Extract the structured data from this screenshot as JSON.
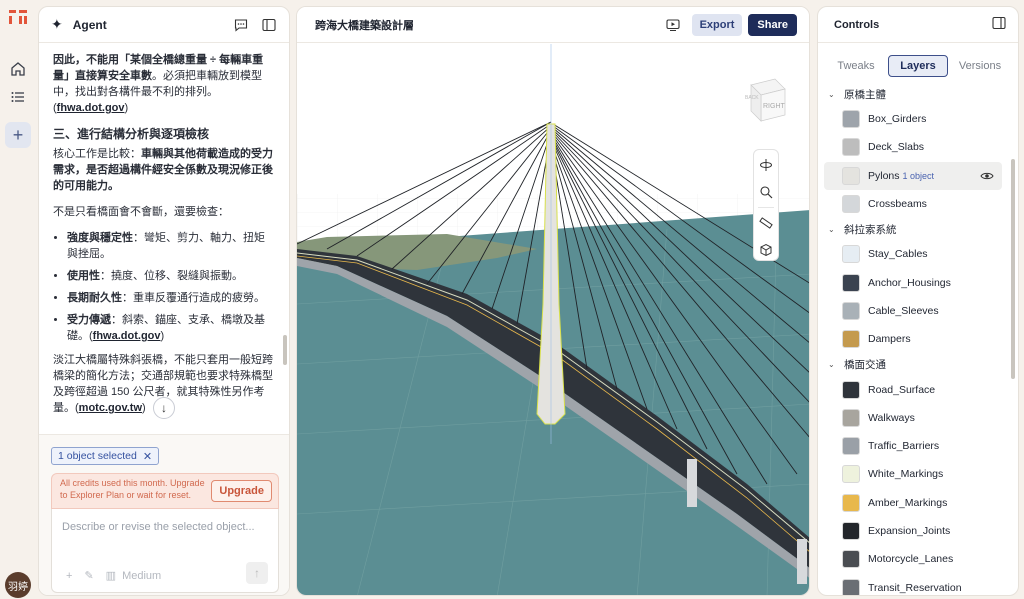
{
  "rail": {
    "items": [
      "home-icon",
      "list-icon",
      "plus-icon"
    ],
    "avatar": "羽婷"
  },
  "agent": {
    "title": "Agent",
    "p1a": "因此，不能用「某個全橋總重量 ÷ 每輛車重量」直接算安全車數",
    "p1b": "。必須把車輛放到模型中，找出對各構件最不利的排列。(",
    "p1link": "fhwa.dot.gov",
    "p1c": ")",
    "h3": "三、進行結構分析與逐項檢核",
    "p2a": "核心工作是比較：",
    "p2b": "車輛與其他荷載造成的受力需求，是否超過構件經安全係數及現況修正後的可用能力。",
    "p3": "不是只看橋面會不會斷，還要檢查：",
    "bullets": [
      {
        "b": "強度與穩定性",
        "t": "：彎矩、剪力、軸力、扭矩與挫屈。"
      },
      {
        "b": "使用性",
        "t": "：撓度、位移、裂縫與振動。"
      },
      {
        "b": "長期耐久性",
        "t": "：重車反覆通行造成的疲勞。"
      },
      {
        "b": "受力傳遞",
        "t": "：斜索、錨座、支承、橋墩及基礎。(",
        "link": "fhwa.dot.gov",
        "end": ")"
      }
    ],
    "p4": "淡江大橋屬特殊斜張橋，不能只套用一般短跨橋梁的簡化方法；交通部規範也要求特殊橋型及跨徑超過 150 公尺者，就其特殊性另作考量。(",
    "p4link": "motc.gov.tw",
    "p4end": ")",
    "selected_chip": "1 object selected",
    "credits_text": "All credits used this month. Upgrade to Explorer Plan or wait for reset.",
    "upgrade_label": "Upgrade",
    "input_placeholder": "Describe or revise the selected object...",
    "model_label": "Medium"
  },
  "viewport": {
    "title": "跨海大橋建築設計層",
    "export_label": "Export",
    "share_label": "Share",
    "cube_label": "RIGHT",
    "cube_label2": "BACK"
  },
  "controls": {
    "title": "Controls",
    "tabs": [
      "Tweaks",
      "Layers",
      "Versions"
    ],
    "active_tab": "Layers",
    "groups": [
      {
        "name": "原橋主體",
        "layers": [
          {
            "name": "Box_Girders",
            "color": "#9ea4ab"
          },
          {
            "name": "Deck_Slabs",
            "color": "#bdbdbd"
          },
          {
            "name": "Pylons",
            "color": "#e4e3df",
            "count": "1 object",
            "selected": true
          },
          {
            "name": "Crossbeams",
            "color": "#d4d7da"
          }
        ]
      },
      {
        "name": "斜拉索系統",
        "layers": [
          {
            "name": "Stay_Cables",
            "color": "#e6edf3"
          },
          {
            "name": "Anchor_Housings",
            "color": "#3b4350"
          },
          {
            "name": "Cable_Sleeves",
            "color": "#a9b1b7"
          },
          {
            "name": "Dampers",
            "color": "#c49a4e"
          }
        ]
      },
      {
        "name": "橋面交通",
        "layers": [
          {
            "name": "Road_Surface",
            "color": "#2f343b"
          },
          {
            "name": "Walkways",
            "color": "#a8a59e"
          },
          {
            "name": "Traffic_Barriers",
            "color": "#9aa0a7"
          },
          {
            "name": "White_Markings",
            "color": "#eef2dd"
          },
          {
            "name": "Amber_Markings",
            "color": "#e8b84c"
          },
          {
            "name": "Expansion_Joints",
            "color": "#23262b"
          },
          {
            "name": "Motorcycle_Lanes",
            "color": "#4a4d52"
          },
          {
            "name": "Transit_Reservation",
            "color": "#6a6e74"
          }
        ]
      }
    ]
  }
}
